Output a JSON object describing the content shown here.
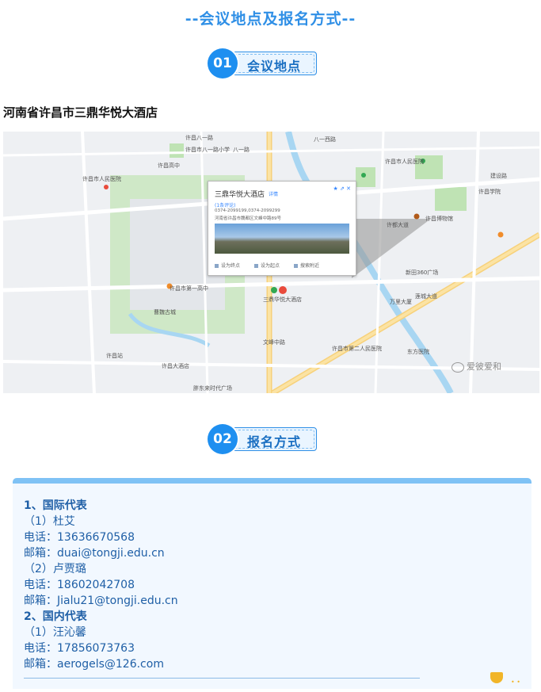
{
  "page_title": "--会议地点及报名方式--",
  "sections": [
    {
      "number": "01",
      "label": "会议地点"
    },
    {
      "number": "02",
      "label": "报名方式"
    }
  ],
  "venue": {
    "address": "河南省许昌市三鼎华悦大酒店"
  },
  "map": {
    "popup": {
      "title": "三鼎华悦大酒店",
      "detail_link": "详情",
      "rating": "(1条评论)",
      "phone": "0374-2099199,0374-2099299",
      "address": "河南省许昌市魏都区文峰中路89号",
      "actions": [
        "设为终点",
        "设为起点",
        "搜索附近"
      ]
    },
    "labels": [
      "八一西路",
      "许昌高中",
      "许昌市八一路小学",
      "八一路",
      "许昌市人民医院",
      "许昌大酒店",
      "许昌八一路",
      "建设路",
      "许昌学院",
      "许昌博物馆",
      "许都大道",
      "莲城大道",
      "万里大厦",
      "东方医院",
      "许昌站",
      "许昌市人民医院",
      "三鼎华悦大酒店",
      "文峰中路",
      "新田360广场",
      "许昌市第二人民医院",
      "曹魏古城",
      "许昌市第一高中",
      "胖东来时代广场"
    ],
    "watermark": "爱彼爱和"
  },
  "contacts": {
    "lines": [
      {
        "text": "1、国际代表",
        "bold": true
      },
      {
        "text": "（1）杜艾",
        "bold": false
      },
      {
        "text": "电话：13636670568",
        "bold": false
      },
      {
        "text": "邮箱：duai@tongji.edu.cn",
        "bold": false
      },
      {
        "text": "（2）卢贾璐",
        "bold": false
      },
      {
        "text": "电话：18602042708",
        "bold": false
      },
      {
        "text": "邮箱：Jialu21@tongji.edu.cn",
        "bold": false
      },
      {
        "text": "2、国内代表",
        "bold": true
      },
      {
        "text": "（1）汪沁馨",
        "bold": false
      },
      {
        "text": "电话：17856073763",
        "bold": false
      },
      {
        "text": "邮箱：aerogels@126.com",
        "bold": false
      }
    ]
  },
  "colors": {
    "accent": "#1e8ff0",
    "title": "#2f8fe6",
    "contact_text": "#1f5fa6",
    "card_bg": "#f2f8ff"
  }
}
